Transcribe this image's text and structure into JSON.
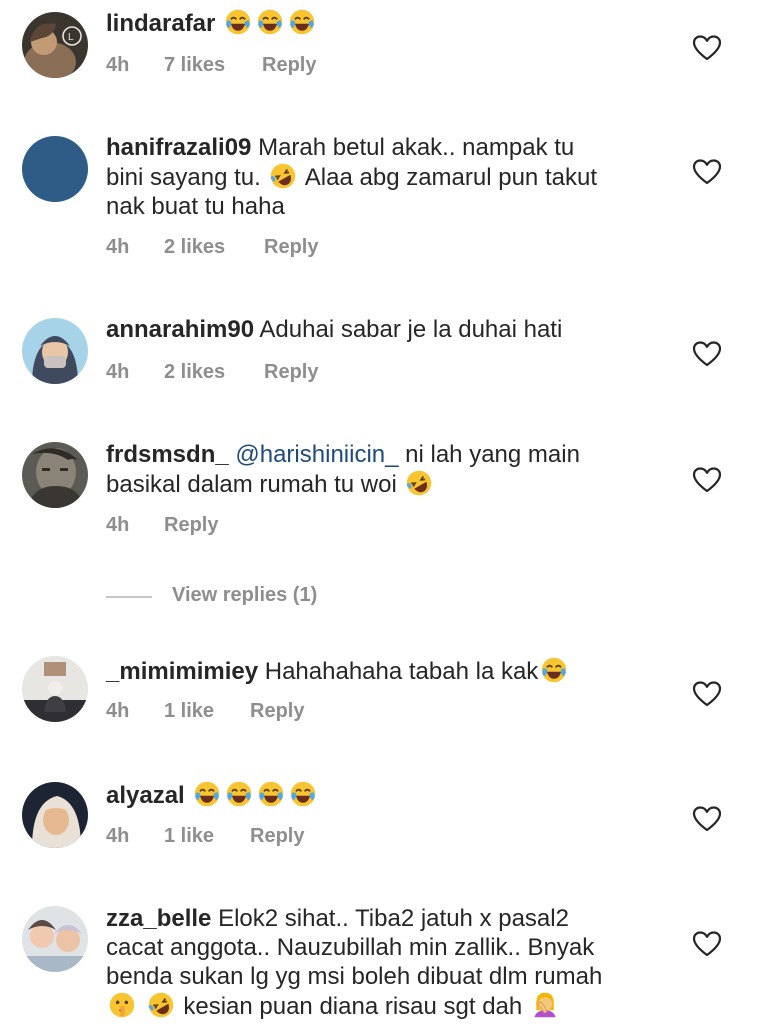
{
  "comments": [
    {
      "username": "lindarafar",
      "text": "",
      "time": "4h",
      "likes": "7 likes",
      "reply": "Reply"
    },
    {
      "username": "hanifrazali09",
      "text_line1": "Marah betul akak.. nampak tu",
      "text_line2a": "bini sayang tu.",
      "text_line2b": "Alaa abg zamarul pun takut",
      "text_line3": "nak buat tu haha",
      "time": "4h",
      "likes": "2 likes",
      "reply": "Reply"
    },
    {
      "username": "annarahim90",
      "text": "Aduhai sabar je la duhai hati",
      "time": "4h",
      "likes": "2 likes",
      "reply": "Reply"
    },
    {
      "username": "frdsmsdn_",
      "mention": "@harishiniicin_",
      "text_line1": "ni lah yang main",
      "text_line2": "basikal dalam rumah tu woi",
      "time": "4h",
      "reply": "Reply"
    },
    {
      "username": "_mimimimiey",
      "text": "Hahahahaha tabah la kak",
      "time": "4h",
      "likes": "1 like",
      "reply": "Reply"
    },
    {
      "username": "alyazal",
      "time": "4h",
      "likes": "1 like",
      "reply": "Reply"
    },
    {
      "username": "zza_belle",
      "text_line1": "Elok2 sihat.. Tiba2 jatuh x pasal2",
      "text_line2": "cacat anggota.. Nauzubillah min zallik.. Bnyak",
      "text_line3": "benda sukan lg yg msi boleh dibuat dlm rumah",
      "text_line4": "kesian puan diana risau sgt dah"
    }
  ],
  "view_replies": "View replies (1)",
  "colors": {
    "meta": "#8e8e8e",
    "mention": "#1f4b7a",
    "username": "#262626"
  },
  "icons": {
    "like": "heart-outline-icon",
    "laugh": "face-with-tears-of-joy-emoji",
    "rofl": "rolling-on-the-floor-laughing-emoji",
    "shush": "shushing-face-emoji",
    "facepalm": "woman-facepalming-emoji"
  }
}
